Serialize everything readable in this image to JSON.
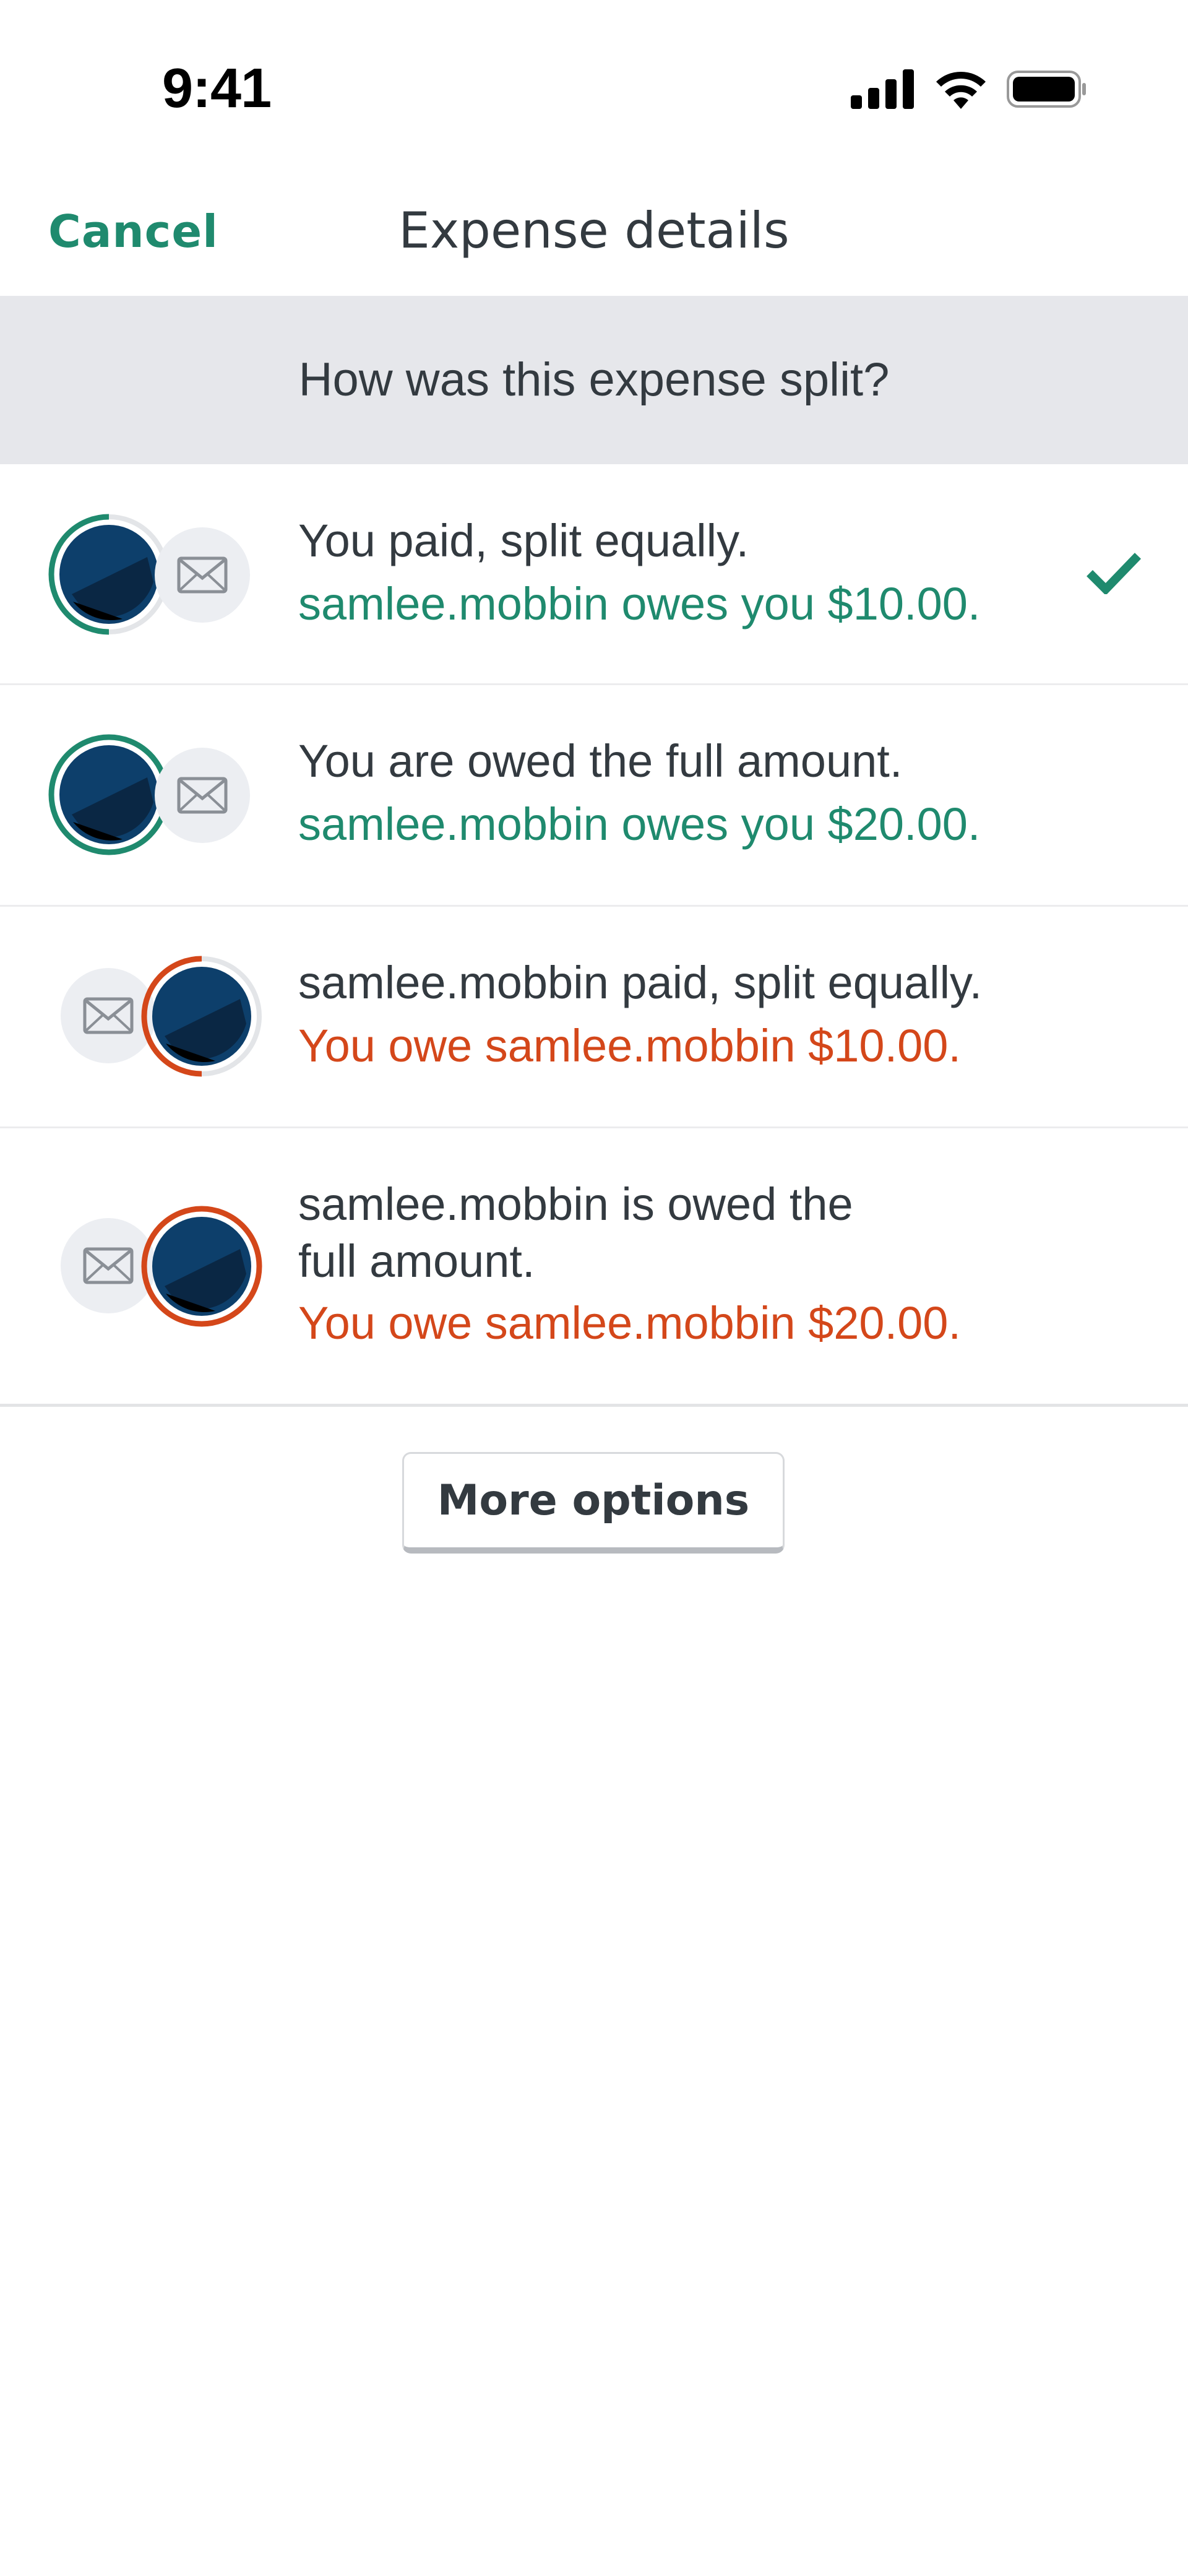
{
  "status_bar": {
    "time": "9:41"
  },
  "nav": {
    "cancel_label": "Cancel",
    "title": "Expense details"
  },
  "section": {
    "prompt": "How was this expense split?"
  },
  "options": [
    {
      "title": "You paid, split equally.",
      "detail": "samlee.mobbin owes you $10.00.",
      "detail_color": "#1f8a6e",
      "selected": true
    },
    {
      "title": "You are owed the full amount.",
      "detail": "samlee.mobbin owes you $20.00.",
      "detail_color": "#1f8a6e",
      "selected": false
    },
    {
      "title": "samlee.mobbin paid, split equally.",
      "detail": "You owe samlee.mobbin $10.00.",
      "detail_color": "#d4471a",
      "selected": false
    },
    {
      "title_line_1": "samlee.mobbin is owed the",
      "title_line_2": "full amount.",
      "detail": "You owe samlee.mobbin $20.00.",
      "detail_color": "#d4471a",
      "selected": false
    }
  ],
  "more_options_label": "More options",
  "icons": {
    "selected": "checkmark-icon",
    "invitee": "mail-icon",
    "signal": "cellular-signal-icon",
    "wifi": "wifi-icon",
    "battery": "battery-icon"
  },
  "colors": {
    "accent_green": "#1f8a6e",
    "accent_orange": "#d4471a",
    "section_bg": "#e6e7eb"
  }
}
